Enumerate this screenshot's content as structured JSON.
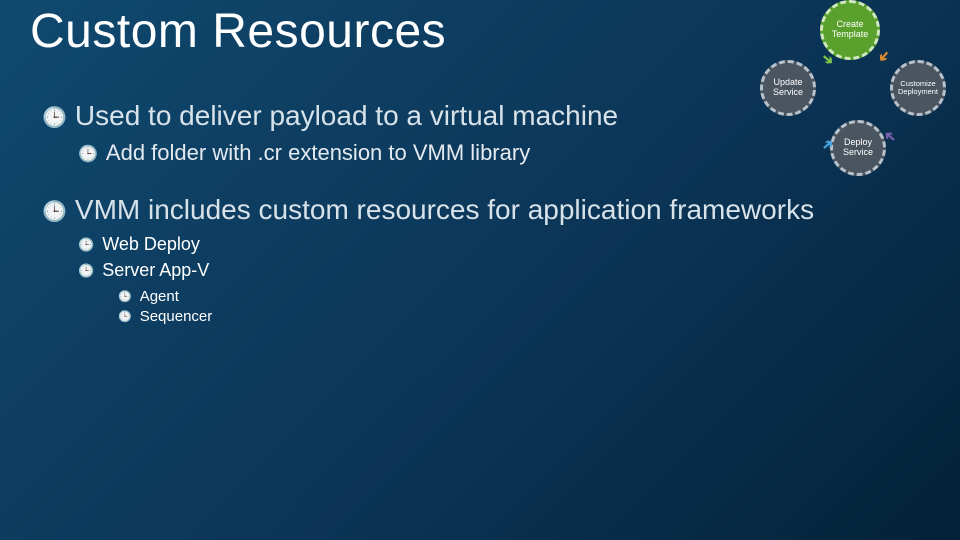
{
  "title": "Custom Resources",
  "bullets": {
    "p1": "Used to deliver payload to a virtual machine",
    "p1a": "Add folder with .cr extension to VMM library",
    "p2": "VMM includes custom resources for application frameworks",
    "p2a": "Web Deploy",
    "p2b": "Server App-V",
    "p2b1": "Agent",
    "p2b2": "Sequencer"
  },
  "diagram": {
    "create": "Create Template",
    "update": "Update Service",
    "customize": "Customize Deployment",
    "deploy": "Deploy Service"
  }
}
